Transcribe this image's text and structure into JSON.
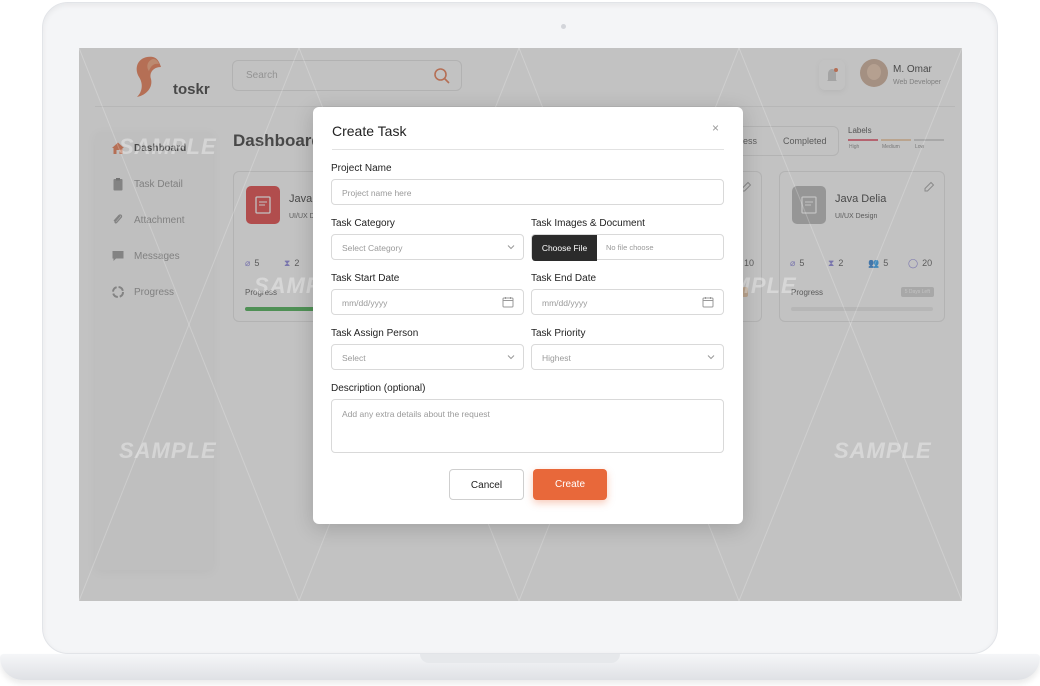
{
  "brand": {
    "name": "toskr",
    "accent": "#e8683a",
    "logo_color": "#e8683a"
  },
  "header": {
    "search_placeholder": "Search",
    "user": {
      "name": "M. Omar",
      "role": "Web Developer"
    }
  },
  "sidebar": {
    "items": [
      {
        "label": "Dashboard",
        "icon": "home-icon",
        "active": true
      },
      {
        "label": "Task Detail",
        "icon": "clipboard-icon",
        "active": false
      },
      {
        "label": "Attachment",
        "icon": "paperclip-icon",
        "active": false
      },
      {
        "label": "Messages",
        "icon": "chat-bubble-icon",
        "active": false
      },
      {
        "label": "Progress",
        "icon": "progress-ring-icon",
        "active": false
      }
    ]
  },
  "main": {
    "title": "Dashboard",
    "tabs": [
      "ogress",
      "Completed"
    ],
    "labels_legend": {
      "title": "Labels",
      "items": [
        {
          "label": "High",
          "color": "#e8556b"
        },
        {
          "label": "Medium",
          "color": "#f0c8a0"
        },
        {
          "label": "Low",
          "color": "#cfcfcf"
        }
      ]
    },
    "cards": [
      {
        "title": "Java",
        "subtitle": "UI/UX D",
        "icon_color": "#e02b2b",
        "attachments": "5",
        "timer": "2",
        "progress_label": "Progress",
        "progress": 0.5
      },
      {
        "comments": "10"
      },
      {
        "title": "Java Delia",
        "subtitle": "UI/UX Design",
        "icon_color": "#b0b0b0",
        "attachments": "5",
        "timer": "2",
        "members": "5",
        "comments": "20",
        "progress_label": "Progress",
        "days_left": "5 Days Left",
        "progress": 0
      }
    ]
  },
  "watermark": "SAMPLE",
  "modal": {
    "title": "Create Task",
    "close": "×",
    "project_name": {
      "label": "Project Name",
      "placeholder": "Project name here"
    },
    "task_category": {
      "label": "Task Category",
      "placeholder": "Select Category"
    },
    "task_images": {
      "label": "Task Images & Document",
      "button": "Choose File",
      "status": "No file choose"
    },
    "start_date": {
      "label": "Task Start Date",
      "placeholder": "mm/dd/yyyy"
    },
    "end_date": {
      "label": "Task End Date",
      "placeholder": "mm/dd/yyyy"
    },
    "assign_person": {
      "label": "Task Assign Person",
      "placeholder": "Select"
    },
    "priority": {
      "label": "Task Priority",
      "value": "Highest"
    },
    "description": {
      "label": "Description (optional)",
      "placeholder": "Add any extra details about the request"
    },
    "cancel": "Cancel",
    "create": "Create"
  }
}
